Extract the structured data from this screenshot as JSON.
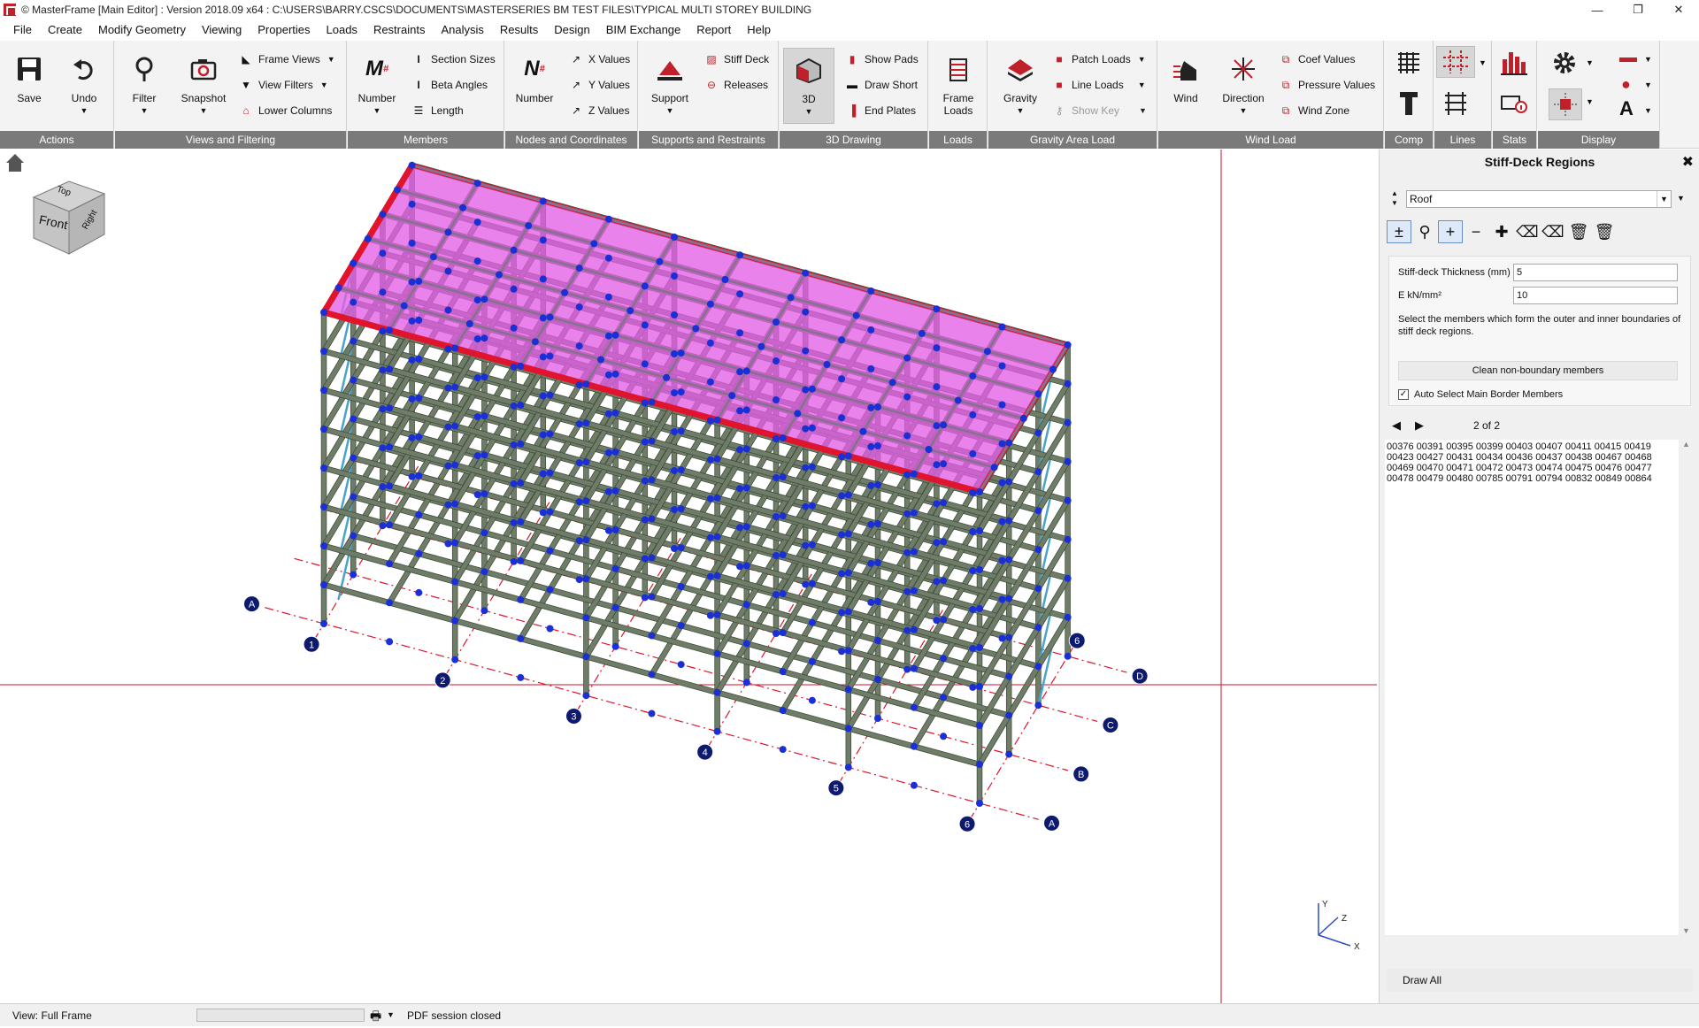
{
  "window": {
    "title": "© MasterFrame [Main Editor] : Version 2018.09 x64 : C:\\USERS\\BARRY.CSCS\\DOCUMENTS\\MASTERSERIES BM TEST FILES\\TYPICAL MULTI STOREY BUILDING",
    "minimize": "—",
    "restore": "❐",
    "close": "✕"
  },
  "menu": [
    "File",
    "Create",
    "Modify Geometry",
    "Viewing",
    "Properties",
    "Loads",
    "Restraints",
    "Analysis",
    "Results",
    "Design",
    "BIM Exchange",
    "Report",
    "Help"
  ],
  "ribbon": {
    "groups": {
      "actions": "Actions",
      "views": "Views and Filtering",
      "members": "Members",
      "nodes": "Nodes and Coordinates",
      "supports": "Supports and Restraints",
      "drawing3d": "3D Drawing",
      "loads": "Loads",
      "gravity": "Gravity Area Load",
      "wind": "Wind Load",
      "comp": "Comp",
      "lines": "Lines",
      "stats": "Stats",
      "display": "Display"
    },
    "buttons": {
      "save": "Save",
      "undo": "Undo",
      "filter": "Filter",
      "snapshot": "Snapshot",
      "frame_views": "Frame Views",
      "view_filters": "View Filters",
      "lower_columns": "Lower Columns",
      "member_number": "Number",
      "section_sizes": "Section Sizes",
      "beta_angles": "Beta Angles",
      "length": "Length",
      "node_number": "Number",
      "x_values": "X Values",
      "y_values": "Y Values",
      "z_values": "Z Values",
      "support": "Support",
      "stiff_deck": "Stiff Deck",
      "releases": "Releases",
      "three_d": "3D",
      "show_pads": "Show Pads",
      "draw_short": "Draw Short",
      "end_plates": "End Plates",
      "frame_loads_1": "Frame",
      "frame_loads_2": "Loads",
      "gravity": "Gravity",
      "patch_loads": "Patch Loads",
      "line_loads": "Line Loads",
      "show_key": "Show Key",
      "wind": "Wind",
      "direction": "Direction",
      "coef_values": "Coef Values",
      "pressure_values": "Pressure Values",
      "wind_zone": "Wind Zone"
    }
  },
  "viewport": {
    "view_cube": {
      "top": "Top",
      "front": "Front",
      "right": "Right"
    },
    "grid_letters": [
      "A",
      "B",
      "C",
      "D"
    ],
    "grid_numbers": [
      "1",
      "2",
      "3",
      "4",
      "5",
      "6"
    ],
    "axes": {
      "x": "X",
      "y": "Y",
      "z": "Z"
    },
    "colors": {
      "member": "#6f7d68",
      "node": "#1a2fd6",
      "deck_fill": "#e35fe6",
      "deck_edge": "#e0142c",
      "grid_line": "#e0142c",
      "brace": "#4aa3c8",
      "grid_bubble": "#0d1a6e"
    }
  },
  "panel": {
    "title": "Stiff-Deck Regions",
    "close": "✖",
    "region_select": "Roof",
    "thickness_label": "Stiff-deck Thickness (mm)",
    "thickness_value": "5",
    "e_label": "E kN/mm²",
    "e_value": "10",
    "help": "Select the members which form the outer and inner boundaries of stiff deck regions.",
    "clean_button": "Clean non-boundary members",
    "auto_select_label": "Auto Select Main Border Members",
    "auto_select_checked": true,
    "page": "2 of 2",
    "members": "00376 00391 00395 00399 00403 00407 00411 00415 00419 00423 00427 00431 00434 00436 00437 00438 00467 00468 00469 00470 00471 00472 00473 00474 00475 00476 00477 00478 00479 00480 00785 00791 00794 00832 00849 00864",
    "draw_all": "Draw All"
  },
  "status": {
    "view": "View: Full Frame",
    "pdf": "PDF session closed"
  }
}
